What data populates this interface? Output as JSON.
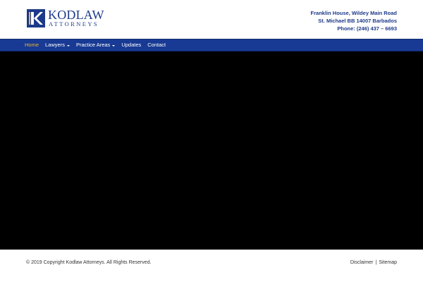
{
  "brand": {
    "name": "KODLAW",
    "subtitle": "ATTORNEYS",
    "colors": {
      "primary": "#1d3a8a",
      "nav": "#183a94",
      "accent": "#f0b429"
    }
  },
  "address": {
    "line1": "Franklin House, Wildey Main Road",
    "line2": "St. Michael BB 14007 Barbados",
    "phone": "Phone: (246) 437 – 6693"
  },
  "nav": {
    "items": [
      {
        "label": "Home",
        "active": true
      },
      {
        "label": "Lawyers",
        "dropdown": true
      },
      {
        "label": "Practice Areas",
        "dropdown": true
      },
      {
        "label": "Updates"
      },
      {
        "label": "Contact"
      }
    ]
  },
  "footer": {
    "copyright": "© 2019 Copyright Kodlaw Attorneys. All Rights Reserved.",
    "links": [
      "Disclaimer",
      "Sitemap"
    ],
    "separator": "|"
  }
}
